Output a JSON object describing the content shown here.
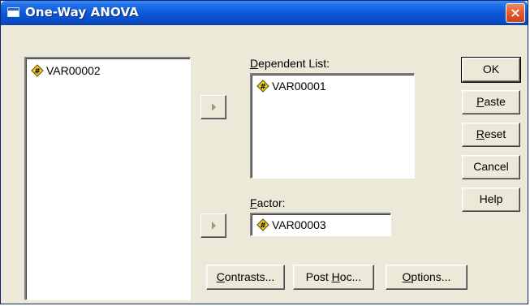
{
  "window": {
    "title": "One-Way ANOVA",
    "close_label": "×"
  },
  "source_list": {
    "items": [
      {
        "label": "VAR00002",
        "icon": "numeric-variable-icon"
      }
    ]
  },
  "dependent_list": {
    "label_prefix": "",
    "label_hotkey": "D",
    "label_rest": "ependent List:",
    "items": [
      {
        "label": "VAR00001",
        "icon": "numeric-variable-icon"
      }
    ]
  },
  "factor": {
    "label_hotkey": "F",
    "label_rest": "actor:",
    "value": "VAR00003",
    "icon": "numeric-variable-icon"
  },
  "buttons": {
    "ok": "OK",
    "paste_hotkey": "P",
    "paste_rest": "aste",
    "reset_hotkey": "R",
    "reset_rest": "eset",
    "cancel": "Cancel",
    "help": "Help"
  },
  "bottom_buttons": {
    "contrasts_hotkey": "C",
    "contrasts_rest": "ontrasts...",
    "posthoc_prefix": "Post ",
    "posthoc_hotkey": "H",
    "posthoc_rest": "oc...",
    "options_hotkey": "O",
    "options_rest": "ptions..."
  },
  "colors": {
    "titlebar": "#0a55d6",
    "dialog_bg": "#ece9d8",
    "close_button": "#e35a2b",
    "variable_icon_fill": "#f5d020"
  }
}
